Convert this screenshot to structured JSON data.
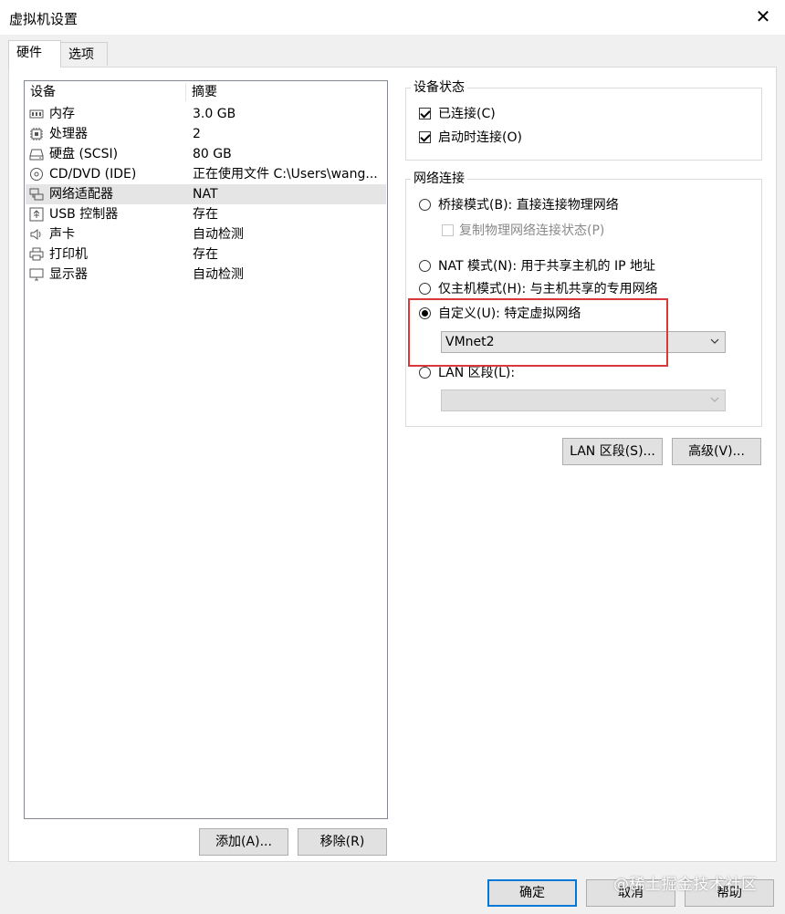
{
  "window": {
    "title": "虚拟机设置"
  },
  "tabs": [
    "硬件",
    "选项"
  ],
  "device_list": {
    "columns": [
      "设备",
      "摘要"
    ],
    "rows": [
      {
        "icon": "memory-icon",
        "device": "内存",
        "summary": "3.0 GB"
      },
      {
        "icon": "processor-icon",
        "device": "处理器",
        "summary": "2"
      },
      {
        "icon": "hard-disk-icon",
        "device": "硬盘 (SCSI)",
        "summary": "80 GB"
      },
      {
        "icon": "cd-dvd-icon",
        "device": "CD/DVD (IDE)",
        "summary": "正在使用文件 C:\\Users\\wang..."
      },
      {
        "icon": "network-adapter-icon",
        "device": "网络适配器",
        "summary": "NAT",
        "selected": true
      },
      {
        "icon": "usb-icon",
        "device": "USB 控制器",
        "summary": "存在"
      },
      {
        "icon": "sound-card-icon",
        "device": "声卡",
        "summary": "自动检测"
      },
      {
        "icon": "printer-icon",
        "device": "打印机",
        "summary": "存在"
      },
      {
        "icon": "display-icon",
        "device": "显示器",
        "summary": "自动检测"
      }
    ],
    "add_label": "添加(A)...",
    "remove_label": "移除(R)"
  },
  "device_status": {
    "title": "设备状态",
    "connected": {
      "label": "已连接(C)",
      "checked": true
    },
    "connect_at_power_on": {
      "label": "启动时连接(O)",
      "checked": true
    }
  },
  "network_connection": {
    "title": "网络连接",
    "bridged": {
      "label": "桥接模式(B): 直接连接物理网络",
      "selected": false
    },
    "replicate": {
      "label": "复制物理网络连接状态(P)",
      "checked": false,
      "disabled": true
    },
    "nat": {
      "label": "NAT 模式(N): 用于共享主机的 IP 地址",
      "selected": false
    },
    "host_only": {
      "label": "仅主机模式(H): 与主机共享的专用网络",
      "selected": false
    },
    "custom": {
      "label": "自定义(U): 特定虚拟网络",
      "selected": true
    },
    "custom_value": "VMnet2",
    "lan_segment": {
      "label": "LAN 区段(L):",
      "selected": false
    },
    "lan_segment_value": ""
  },
  "side_buttons": {
    "lan_segments": "LAN 区段(S)...",
    "advanced": "高级(V)..."
  },
  "footer": {
    "ok": "确定",
    "cancel": "取消",
    "help": "帮助"
  },
  "watermark": "@稀土掘金技术社区",
  "colors": {
    "highlight_border": "#d9383a",
    "primary_button_border": "#0078d7",
    "selection_bg": "#e5e5e5"
  }
}
